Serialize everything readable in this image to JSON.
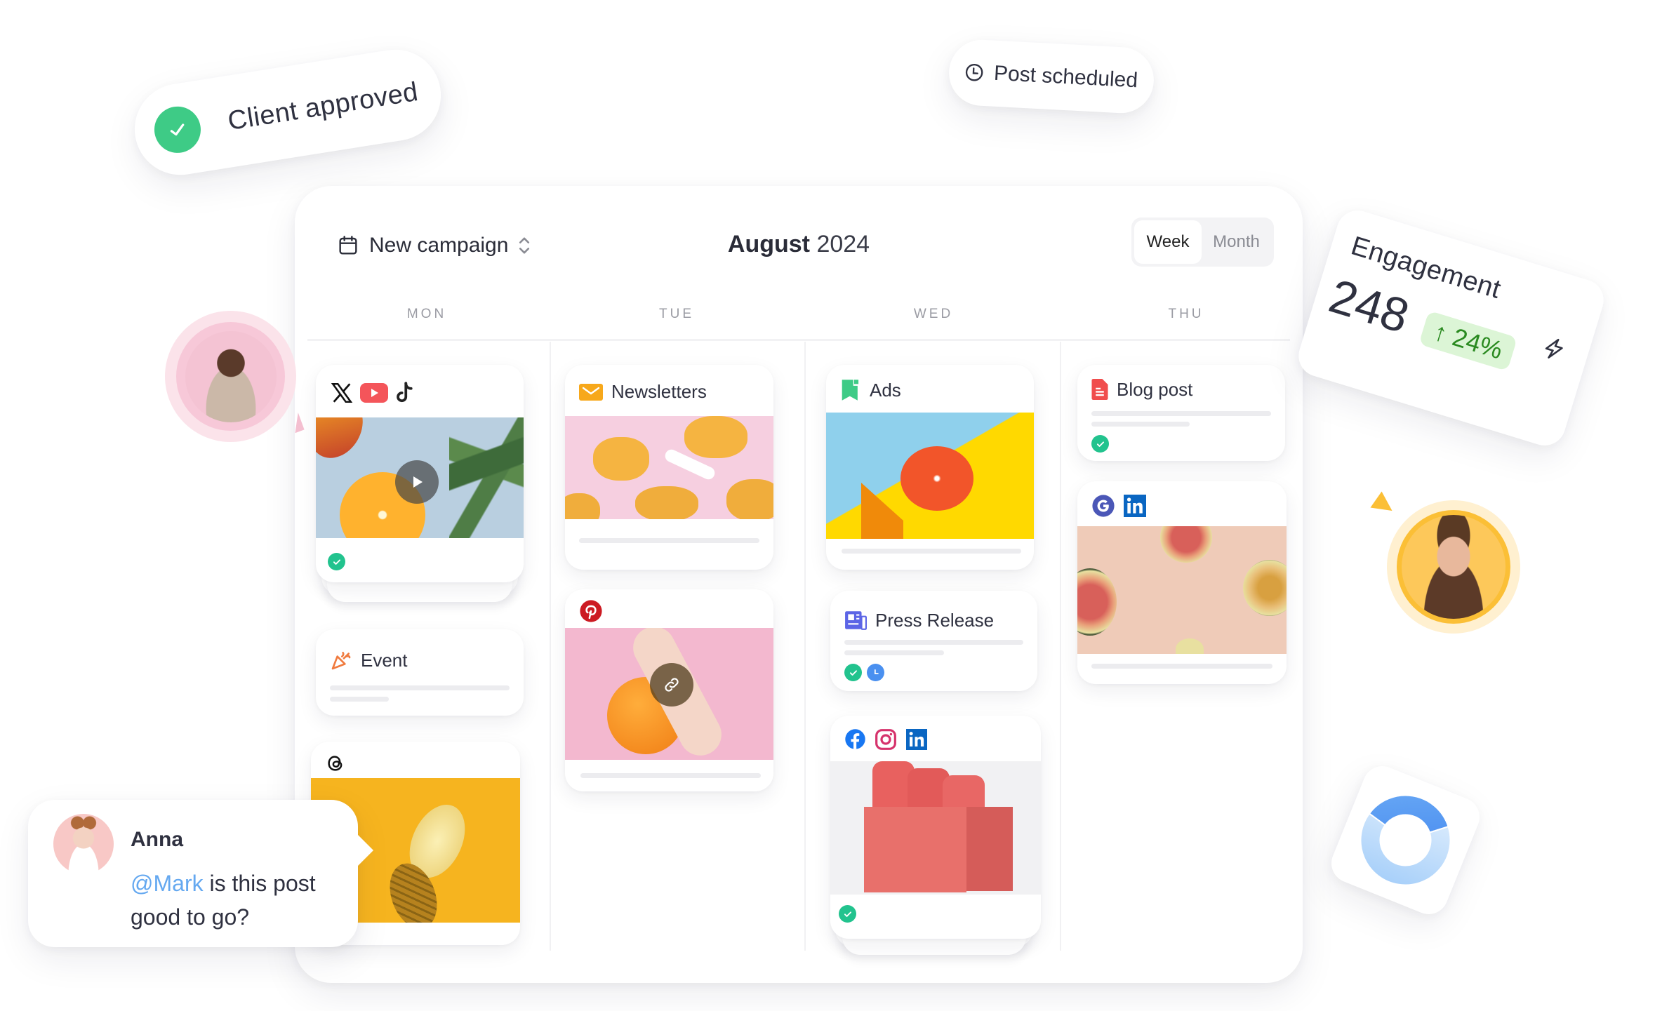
{
  "notifications": {
    "client_approved": "Client approved",
    "post_scheduled": "Post scheduled"
  },
  "calendar": {
    "campaign_selector": {
      "label": "New campaign",
      "icon": "calendar-icon",
      "chevron": "chevron-up-down-icon"
    },
    "month": "August",
    "year": "2024",
    "view_toggle": {
      "options": [
        "Week",
        "Month"
      ],
      "selected": "Week"
    },
    "days": [
      "MON",
      "TUE",
      "WED",
      "THU"
    ],
    "columns": {
      "mon": [
        {
          "type": "social",
          "platforms": [
            "x-icon",
            "youtube-icon",
            "tiktok-icon"
          ],
          "image": "orange-pineapple-video",
          "overlay": "play-icon",
          "status": [
            "approved"
          ]
        },
        {
          "type": "note",
          "title": "Event",
          "icon": "party-popper-icon"
        },
        {
          "type": "social",
          "platforms": [
            "threads-icon"
          ],
          "image": "pineapple-yellow"
        }
      ],
      "tue": [
        {
          "type": "titled-media",
          "title": "Newsletters",
          "icon": "mail-icon",
          "image": "dried-fruit-pink"
        },
        {
          "type": "social",
          "platforms": [
            "pinterest-icon"
          ],
          "image": "hand-orange-pink",
          "overlay": "link-icon"
        }
      ],
      "wed": [
        {
          "type": "titled-media",
          "title": "Ads",
          "icon": "bookmark-flag-icon",
          "image": "grapefruit-blue-yellow"
        },
        {
          "type": "note",
          "title": "Press Release",
          "icon": "newspaper-icon",
          "status": [
            "approved",
            "scheduled"
          ]
        },
        {
          "type": "social",
          "platforms": [
            "facebook-icon",
            "instagram-icon",
            "linkedin-icon"
          ],
          "image": "juice-bottles-6-pack",
          "status": [
            "approved"
          ]
        }
      ],
      "thu": [
        {
          "type": "note",
          "title": "Blog post",
          "icon": "document-icon",
          "status": [
            "approved"
          ]
        },
        {
          "type": "social",
          "platforms": [
            "google-icon",
            "linkedin-icon"
          ],
          "image": "figs-peach"
        }
      ]
    }
  },
  "engagement": {
    "label": "Engagement",
    "value": "248",
    "change": "24%",
    "change_direction": "up",
    "icon": "lightning-icon"
  },
  "comment": {
    "author": "Anna",
    "mention": "@Mark",
    "message": " is this post good to go?"
  },
  "donut": {
    "chart_data": {
      "type": "pie",
      "values": [
        35,
        65
      ],
      "labels": [
        "",
        ""
      ]
    }
  },
  "colors": {
    "approved": "#22c38e",
    "scheduled": "#4a90f0",
    "engagement_badge_bg": "#dcf5d6",
    "engagement_badge_text": "#2a8a20",
    "mention": "#64a8f0"
  }
}
